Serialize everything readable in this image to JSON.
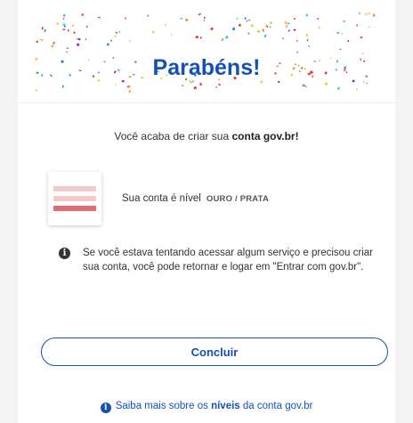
{
  "colors": {
    "accent": "#1351b4",
    "badge_stripes": [
      "#f3c9cc",
      "#f3c9cc",
      "#e06b73"
    ]
  },
  "header": {
    "title": "Parabéns!"
  },
  "message": {
    "prefix": "Você acaba de criar sua ",
    "highlight": "conta gov.br!"
  },
  "account_level": {
    "label": "Sua conta é nível",
    "value": "OURO / PRATA",
    "badge_icon": "level-badge-icon"
  },
  "info": {
    "icon": "info-icon",
    "text": "Se você estava tentando acessar algum serviço e precisou criar sua conta, você pode retornar e logar em \"Entrar com gov.br\"."
  },
  "primary_button": {
    "label": "Concluir"
  },
  "footer": {
    "icon": "info-icon",
    "prefix": "Saiba mais sobre os ",
    "link": "níveis",
    "suffix": " da conta gov.br"
  }
}
